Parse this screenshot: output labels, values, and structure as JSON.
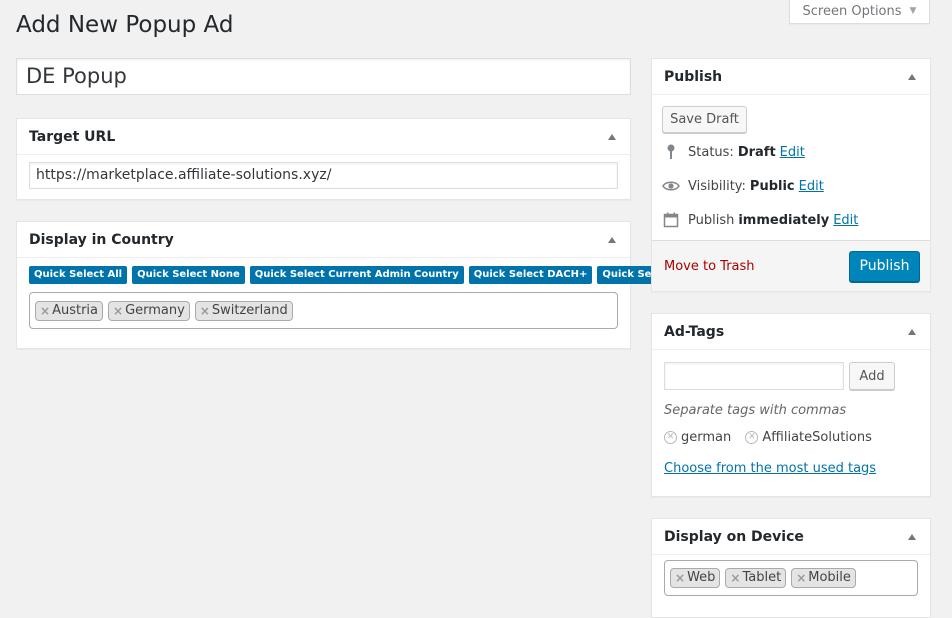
{
  "screen_options": {
    "label": "Screen Options"
  },
  "page": {
    "title": "Add New Popup Ad"
  },
  "title_field": {
    "value": "DE Popup"
  },
  "target_url": {
    "heading": "Target URL",
    "value": "https://marketplace.affiliate-solutions.xyz/"
  },
  "display_country": {
    "heading": "Display in Country",
    "quick_buttons": [
      "Quick Select All",
      "Quick Select None",
      "Quick Select Current Admin Country",
      "Quick Select DACH+",
      "Quick Select DACH-"
    ],
    "selected": [
      "Austria",
      "Germany",
      "Switzerland"
    ]
  },
  "publish": {
    "heading": "Publish",
    "save_draft": "Save Draft",
    "status_label": "Status:",
    "status_value": "Draft",
    "visibility_label": "Visibility:",
    "visibility_value": "Public",
    "publish_label": "Publish",
    "publish_value": "immediately",
    "edit": "Edit",
    "move_to_trash": "Move to Trash",
    "publish_button": "Publish"
  },
  "ad_tags": {
    "heading": "Ad-Tags",
    "input_value": "",
    "add_button": "Add",
    "hint": "Separate tags with commas",
    "tags": [
      "german",
      "AffiliateSolutions"
    ],
    "choose_link": "Choose from the most used tags"
  },
  "display_device": {
    "heading": "Display on Device",
    "selected": [
      "Web",
      "Tablet",
      "Mobile"
    ]
  },
  "colors": {
    "accent": "#0073aa",
    "primary_button": "#0085ba",
    "trash": "#a00000"
  }
}
